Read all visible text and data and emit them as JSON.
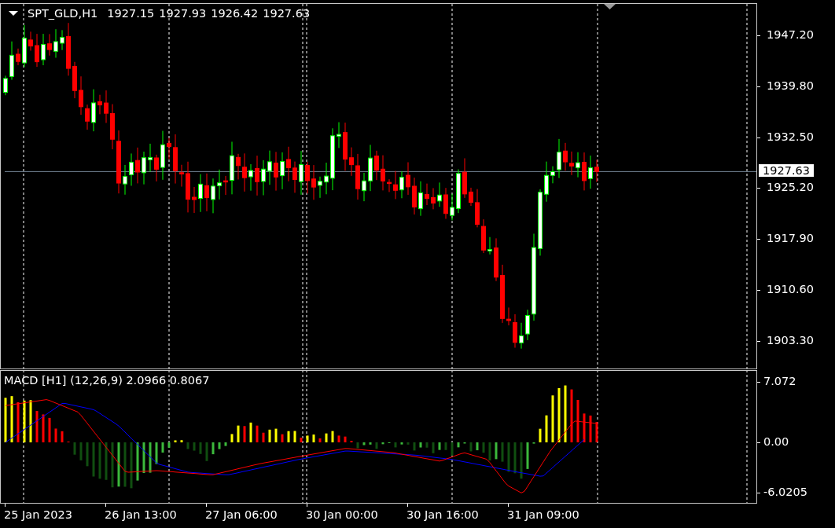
{
  "price_chart": {
    "title": {
      "symbol": "SPT_GLD,H1",
      "ohlc": [
        "1927.15",
        "1927.93",
        "1926.42",
        "1927.63"
      ]
    },
    "price_axis": [
      "1947.20",
      "1939.80",
      "1932.50",
      "1925.20",
      "1917.90",
      "1910.60",
      "1903.30"
    ],
    "current_price": "1927.63"
  },
  "macd_panel": {
    "label": "MACD [H1] (12,26,9) 2.0966 0.8067",
    "axis": [
      "7.072",
      "0.00",
      "-6.0205"
    ]
  },
  "time_axis": [
    "25 Jan 2023",
    "26 Jan 13:00",
    "27 Jan 06:00",
    "30 Jan 00:00",
    "30 Jan 16:00",
    "31 Jan 09:00"
  ]
}
